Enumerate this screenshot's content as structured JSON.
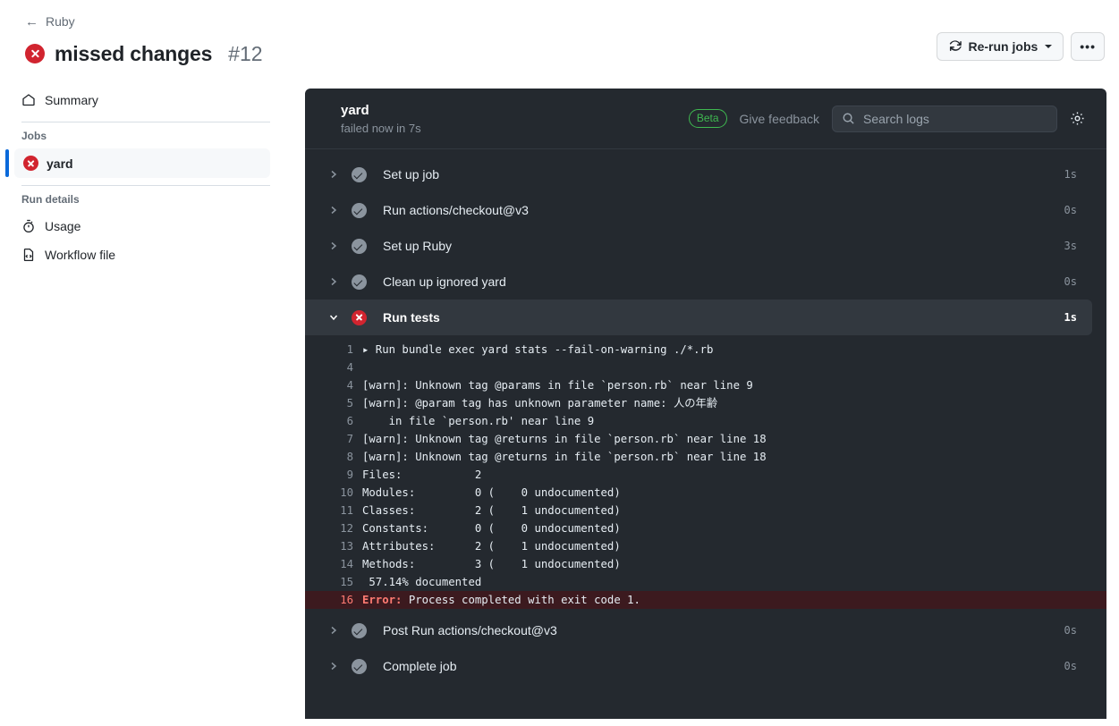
{
  "header": {
    "breadcrumb_back": "Ruby",
    "back_arrow_icon": "arrow-left-icon",
    "status_icon": "x-circle-icon",
    "title": "missed changes",
    "run_number": "#12",
    "rerun_label": "Re-run jobs",
    "rerun_icon": "sync-icon",
    "kebab_label": "•••"
  },
  "sidebar": {
    "summary": {
      "label": "Summary",
      "icon": "home-icon"
    },
    "jobs_label": "Jobs",
    "jobs": [
      {
        "label": "yard",
        "icon": "x-circle-icon",
        "selected": true
      }
    ],
    "run_details_label": "Run details",
    "run_details": [
      {
        "label": "Usage",
        "icon": "stopwatch-icon"
      },
      {
        "label": "Workflow file",
        "icon": "file-code-icon"
      }
    ]
  },
  "log_panel": {
    "title": "yard",
    "subtitle": "failed now in 7s",
    "beta_badge": "Beta",
    "feedback_link": "Give feedback",
    "search_placeholder": "Search logs",
    "search_icon": "search-icon",
    "settings_icon": "gear-icon",
    "steps": [
      {
        "name": "Set up job",
        "status": "success",
        "duration": "1s",
        "expanded": false
      },
      {
        "name": "Run actions/checkout@v3",
        "status": "success",
        "duration": "0s",
        "expanded": false
      },
      {
        "name": "Set up Ruby",
        "status": "success",
        "duration": "3s",
        "expanded": false
      },
      {
        "name": "Clean up ignored yard",
        "status": "success",
        "duration": "0s",
        "expanded": false
      },
      {
        "name": "Run tests",
        "status": "failure",
        "duration": "1s",
        "expanded": true
      }
    ],
    "log_lines": [
      {
        "num": "1",
        "text": "▸ Run bundle exec yard stats --fail-on-warning ./*.rb",
        "type": "command"
      },
      {
        "num": "4",
        "text": "",
        "type": "plain"
      },
      {
        "num": "4",
        "text": "[warn]: Unknown tag @params in file `person.rb` near line 9",
        "type": "plain"
      },
      {
        "num": "5",
        "text": "[warn]: @param tag has unknown parameter name: 人の年齢",
        "type": "plain"
      },
      {
        "num": "6",
        "text": "    in file `person.rb' near line 9",
        "type": "plain"
      },
      {
        "num": "7",
        "text": "[warn]: Unknown tag @returns in file `person.rb` near line 18",
        "type": "plain"
      },
      {
        "num": "8",
        "text": "[warn]: Unknown tag @returns in file `person.rb` near line 18",
        "type": "plain"
      },
      {
        "num": "9",
        "text": "Files:           2",
        "type": "plain"
      },
      {
        "num": "10",
        "text": "Modules:         0 (    0 undocumented)",
        "type": "plain"
      },
      {
        "num": "11",
        "text": "Classes:         2 (    1 undocumented)",
        "type": "plain"
      },
      {
        "num": "12",
        "text": "Constants:       0 (    0 undocumented)",
        "type": "plain"
      },
      {
        "num": "13",
        "text": "Attributes:      2 (    1 undocumented)",
        "type": "plain"
      },
      {
        "num": "14",
        "text": "Methods:         3 (    1 undocumented)",
        "type": "plain"
      },
      {
        "num": "15",
        "text": " 57.14% documented",
        "type": "plain"
      },
      {
        "num": "16",
        "text": "Error: Process completed with exit code 1.",
        "type": "error",
        "error_label": "Error:",
        "error_rest": " Process completed with exit code 1."
      }
    ],
    "steps_after": [
      {
        "name": "Post Run actions/checkout@v3",
        "status": "success",
        "duration": "0s"
      },
      {
        "name": "Complete job",
        "status": "success",
        "duration": "0s"
      }
    ]
  },
  "colors": {
    "accent": "#0969da",
    "danger": "#d1242f",
    "beta_green": "#3fb950",
    "panel_bg": "#24292f",
    "error_row_bg": "#3c1a1f"
  }
}
